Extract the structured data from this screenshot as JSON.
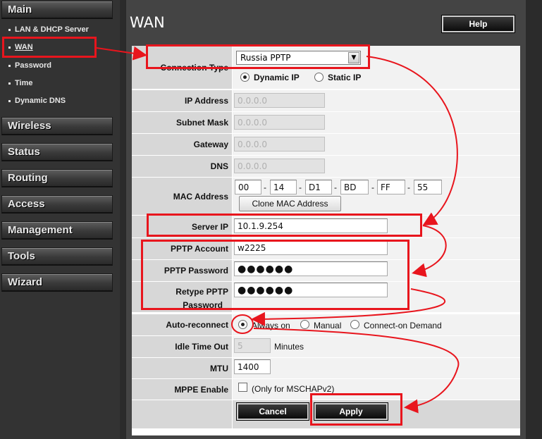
{
  "sidebar": {
    "main_label": "Main",
    "subitems": [
      {
        "label": "LAN & DHCP Server"
      },
      {
        "label": "WAN"
      },
      {
        "label": "Password"
      },
      {
        "label": "Time"
      },
      {
        "label": "Dynamic DNS"
      }
    ],
    "sections": [
      {
        "label": "Wireless"
      },
      {
        "label": "Status"
      },
      {
        "label": "Routing"
      },
      {
        "label": "Access"
      },
      {
        "label": "Management"
      },
      {
        "label": "Tools"
      },
      {
        "label": "Wizard"
      }
    ]
  },
  "header": {
    "title": "WAN",
    "help_label": "Help"
  },
  "form": {
    "connection_type": {
      "label": "Connection Type",
      "value": "Russia PPTP",
      "dynamic_ip": "Dynamic IP",
      "static_ip": "Static IP"
    },
    "ip_address": {
      "label": "IP Address",
      "value": "0.0.0.0"
    },
    "subnet_mask": {
      "label": "Subnet Mask",
      "value": "0.0.0.0"
    },
    "gateway": {
      "label": "Gateway",
      "value": "0.0.0.0"
    },
    "dns": {
      "label": "DNS",
      "value": "0.0.0.0"
    },
    "mac": {
      "label": "MAC Address",
      "octets": [
        "00",
        "14",
        "D1",
        "BD",
        "FF",
        "55"
      ],
      "clone_label": "Clone MAC Address"
    },
    "server_ip": {
      "label": "Server IP",
      "value": "10.1.9.254"
    },
    "pptp_account": {
      "label": "PPTP Account",
      "value": "w2225"
    },
    "pptp_password": {
      "label": "PPTP Password",
      "value": "●●●●●●"
    },
    "retype_password": {
      "label_line1": "Retype PPTP",
      "label_line2": "Password",
      "value": "●●●●●●"
    },
    "auto_reconnect": {
      "label": "Auto-reconnect",
      "options": [
        "Always on",
        "Manual",
        "Connect-on Demand"
      ]
    },
    "idle_time": {
      "label": "Idle Time Out",
      "value": "5",
      "unit": "Minutes"
    },
    "mtu": {
      "label": "MTU",
      "value": "1400"
    },
    "mppe": {
      "label": "MPPE Enable",
      "note": "(Only for MSCHAPv2)"
    }
  },
  "buttons": {
    "cancel": "Cancel",
    "apply": "Apply"
  },
  "colors": {
    "annotation": "#e8151d",
    "sidebar_bg": "#333333",
    "label_bg": "#d7d7d7"
  }
}
